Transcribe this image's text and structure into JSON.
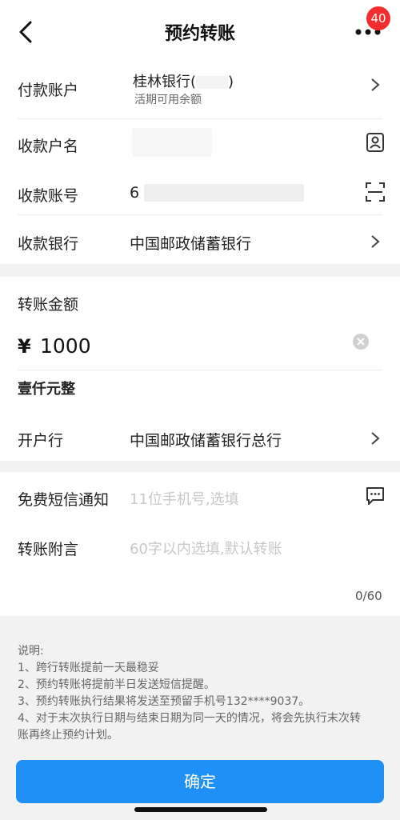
{
  "header": {
    "title": "预约转账",
    "badge": "40"
  },
  "payer": {
    "label": "付款账户",
    "bank": "桂林银行(",
    "bank_tail": ")",
    "balance": "活期可用余额"
  },
  "payee_name": {
    "label": "收款户名"
  },
  "payee_account": {
    "label": "收款账号",
    "value": "6"
  },
  "payee_bank": {
    "label": "收款银行",
    "value": "中国邮政储蓄银行"
  },
  "amount": {
    "label": "转账金额",
    "currency": "¥",
    "value": "1000",
    "upper": "壹仟元整"
  },
  "open_bank": {
    "label": "开户行",
    "value": "中国邮政储蓄银行总行"
  },
  "sms": {
    "label": "免费短信通知",
    "placeholder": "11位手机号,选填"
  },
  "remark": {
    "label": "转账附言",
    "placeholder": "60字以内选填,默认转账",
    "counter": "0/60"
  },
  "notes": {
    "title": "说明:",
    "lines": [
      "1、跨行转账提前一天最稳妥",
      "2、预约转账将提前半日发送短信提醒。",
      "3、预约转账执行结果将发送至预留手机号132****9037。",
      "4、对于末次执行日期与结束日期为同一天的情况，将会先执行末次转",
      "账再终止预约计划。"
    ]
  },
  "confirm_label": "确定",
  "colors": {
    "accent": "#1e8ff5",
    "badge": "#f32d2d"
  }
}
